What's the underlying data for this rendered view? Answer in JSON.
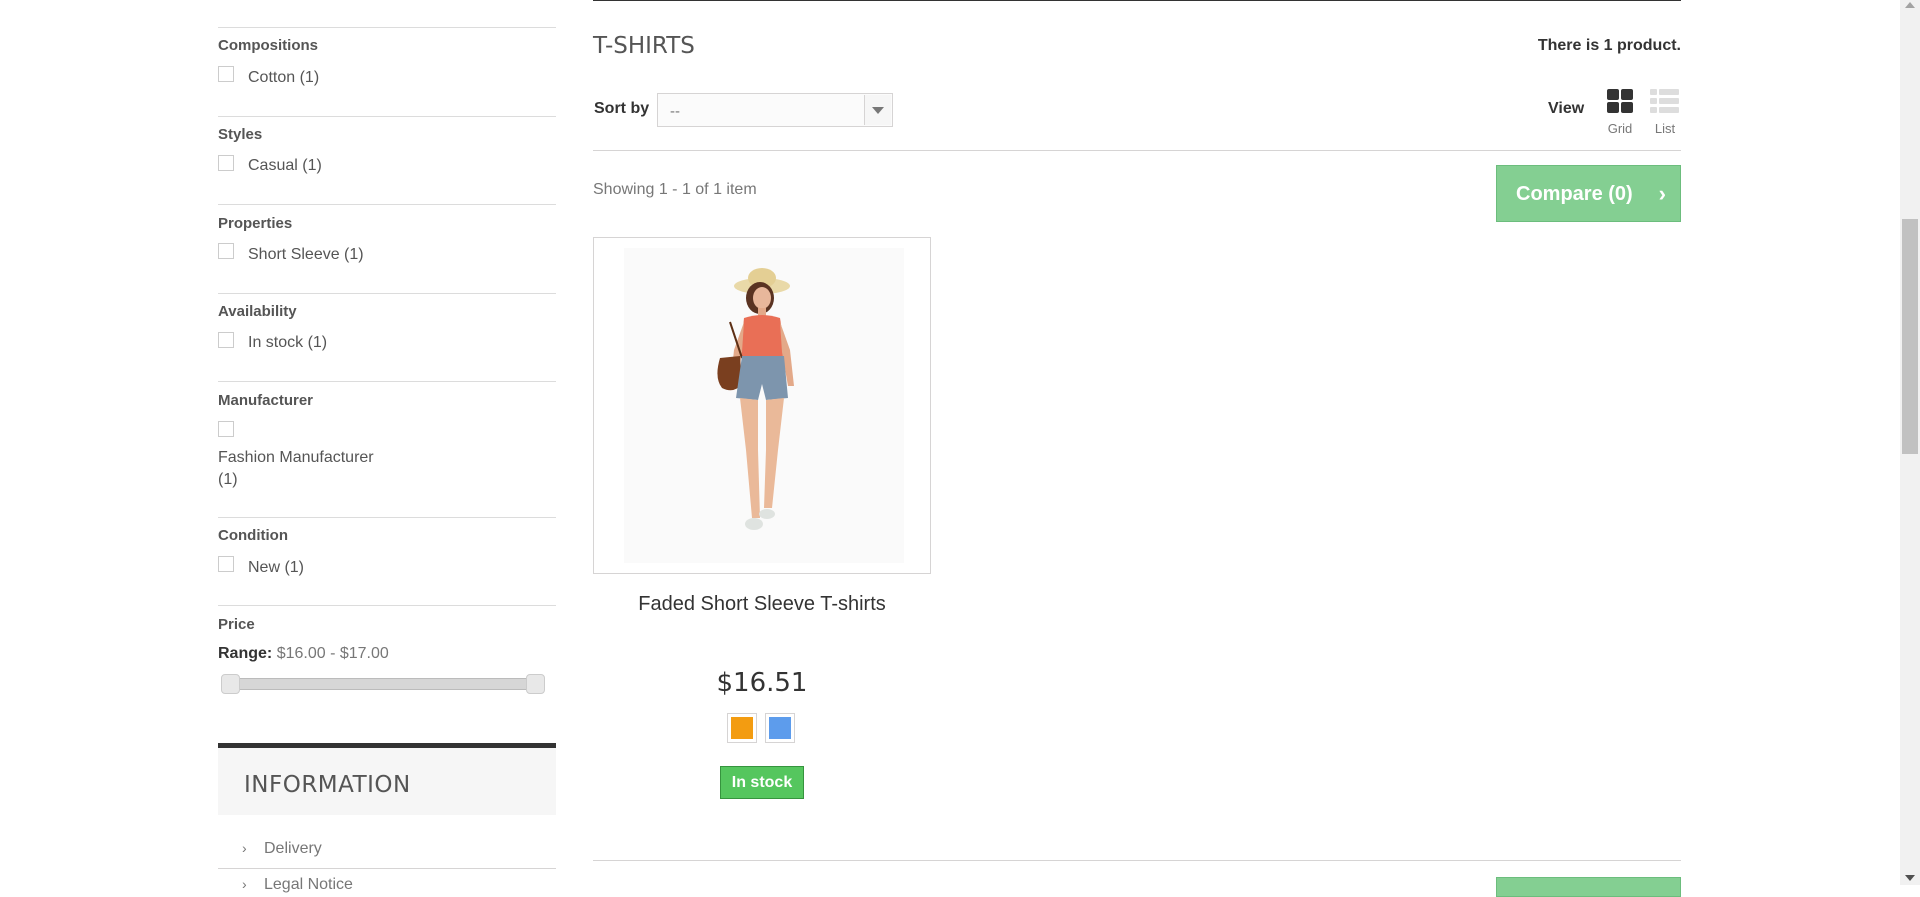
{
  "filters": [
    {
      "title": "Compositions",
      "options": [
        "Cotton (1)"
      ]
    },
    {
      "title": "Styles",
      "options": [
        "Casual (1)"
      ]
    },
    {
      "title": "Properties",
      "options": [
        "Short Sleeve (1)"
      ]
    },
    {
      "title": "Availability",
      "options": [
        "In stock (1)"
      ]
    },
    {
      "title": "Manufacturer",
      "options": [
        "Fashion Manufacturer (1)"
      ]
    },
    {
      "title": "Condition",
      "options": [
        "New (1)"
      ]
    }
  ],
  "manufacturer_option_lines": [
    "Fashion Manufacturer",
    "(1)"
  ],
  "price": {
    "title": "Price",
    "range_label": "Range:",
    "range_value": "$16.00 - $17.00"
  },
  "information": {
    "title": "INFORMATION",
    "links": [
      "Delivery",
      "Legal Notice"
    ]
  },
  "category": {
    "heading": "T-SHIRTS",
    "count_text": "There is 1 product."
  },
  "sort": {
    "label": "Sort by",
    "value": "--"
  },
  "view": {
    "label": "View",
    "grid_label": "Grid",
    "list_label": "List"
  },
  "showing_text": "Showing 1 - 1 of 1 item",
  "compare": {
    "label": "Compare (0)",
    "chevron": "›"
  },
  "product": {
    "name": "Faded Short Sleeve T-shirts",
    "price": "$16.51",
    "colors": [
      "#f39c11",
      "#5d9cec"
    ],
    "stock_label": "In stock",
    "stock_color": "#55c65e"
  },
  "chevron": "›"
}
